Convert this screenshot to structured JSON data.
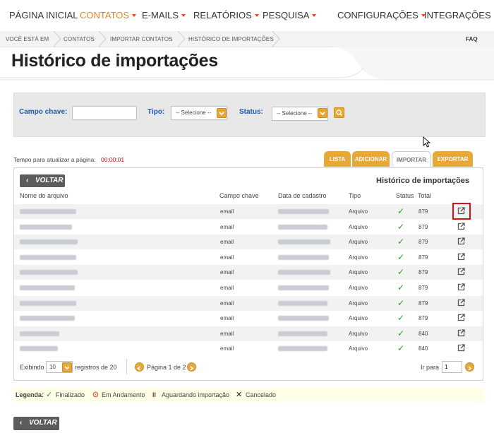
{
  "nav": {
    "items": [
      {
        "label": "PÁGINA INICIAL",
        "dropdown": false,
        "active": false
      },
      {
        "label": "CONTATOS",
        "dropdown": true,
        "active": true
      },
      {
        "label": "E-MAILS",
        "dropdown": true,
        "active": false
      },
      {
        "label": "RELATÓRIOS",
        "dropdown": true,
        "active": false
      },
      {
        "label": "PESQUISA",
        "dropdown": true,
        "active": false
      },
      {
        "label": "CONFIGURAÇÕES",
        "dropdown": true,
        "active": false
      },
      {
        "label": "INTEGRAÇÕES",
        "dropdown": false,
        "active": false
      }
    ]
  },
  "breadcrumb": {
    "items": [
      "VOCÊ ESTÁ EM",
      "CONTATOS",
      "IMPORTAR CONTATOS",
      "HISTÓRICO DE IMPORTAÇÕES"
    ],
    "faq": "FAQ"
  },
  "page": {
    "title": "Histórico de importações"
  },
  "filter": {
    "campo_label": "Campo chave:",
    "campo_value": "",
    "tipo_label": "Tipo:",
    "tipo_value": "-- Selecione --",
    "status_label": "Status:",
    "status_value": "-- Selecione --",
    "search_icon": "search-icon"
  },
  "refresh": {
    "label": "Tempo para atualizar a página:",
    "time": "00:00:01"
  },
  "tabs": [
    {
      "label": "LISTA",
      "active": false
    },
    {
      "label": "ADICIONAR",
      "active": false
    },
    {
      "label": "IMPORTAR",
      "active": true
    },
    {
      "label": "EXPORTAR",
      "active": false
    }
  ],
  "panel": {
    "back_label": "VOLTAR",
    "heading": "Histórico de importações",
    "columns": [
      "Nome do arquivo",
      "Campo chave",
      "Data de cadastro",
      "Tipo",
      "Status",
      "Total"
    ],
    "rows": [
      {
        "campo": "email",
        "tipo": "Arquivo",
        "total": "879",
        "status": "check-icon"
      },
      {
        "campo": "email",
        "tipo": "Arquivo",
        "total": "879",
        "status": "check-icon"
      },
      {
        "campo": "email",
        "tipo": "Arquivo",
        "total": "879",
        "status": "check-icon"
      },
      {
        "campo": "email",
        "tipo": "Arquivo",
        "total": "879",
        "status": "check-icon"
      },
      {
        "campo": "email",
        "tipo": "Arquivo",
        "total": "879",
        "status": "check-icon"
      },
      {
        "campo": "email",
        "tipo": "Arquivo",
        "total": "879",
        "status": "check-icon"
      },
      {
        "campo": "email",
        "tipo": "Arquivo",
        "total": "879",
        "status": "check-icon"
      },
      {
        "campo": "email",
        "tipo": "Arquivo",
        "total": "879",
        "status": "check-icon"
      },
      {
        "campo": "email",
        "tipo": "Arquivo",
        "total": "840",
        "status": "check-icon"
      },
      {
        "campo": "email",
        "tipo": "Arquivo",
        "total": "840",
        "status": "check-icon"
      }
    ]
  },
  "pagination": {
    "exibindo": "Exibindo",
    "per_page": "10",
    "registros": "registros de 20",
    "page_text": "Página 1 de 2",
    "ir_para": "Ir para",
    "goto_value": "1"
  },
  "legend": {
    "title": "Legenda:",
    "finalizado": "Finalizado",
    "andamento": "Em Andamento",
    "aguardando": "Aguardando importação",
    "cancelado": "Cancelado"
  },
  "bottom_back": "VOLTAR",
  "colors": {
    "accent": "#e8a838",
    "nav_active": "#e8831f",
    "link": "#1a5aa8",
    "ok": "#2d9a2d",
    "timer": "#d11010"
  }
}
